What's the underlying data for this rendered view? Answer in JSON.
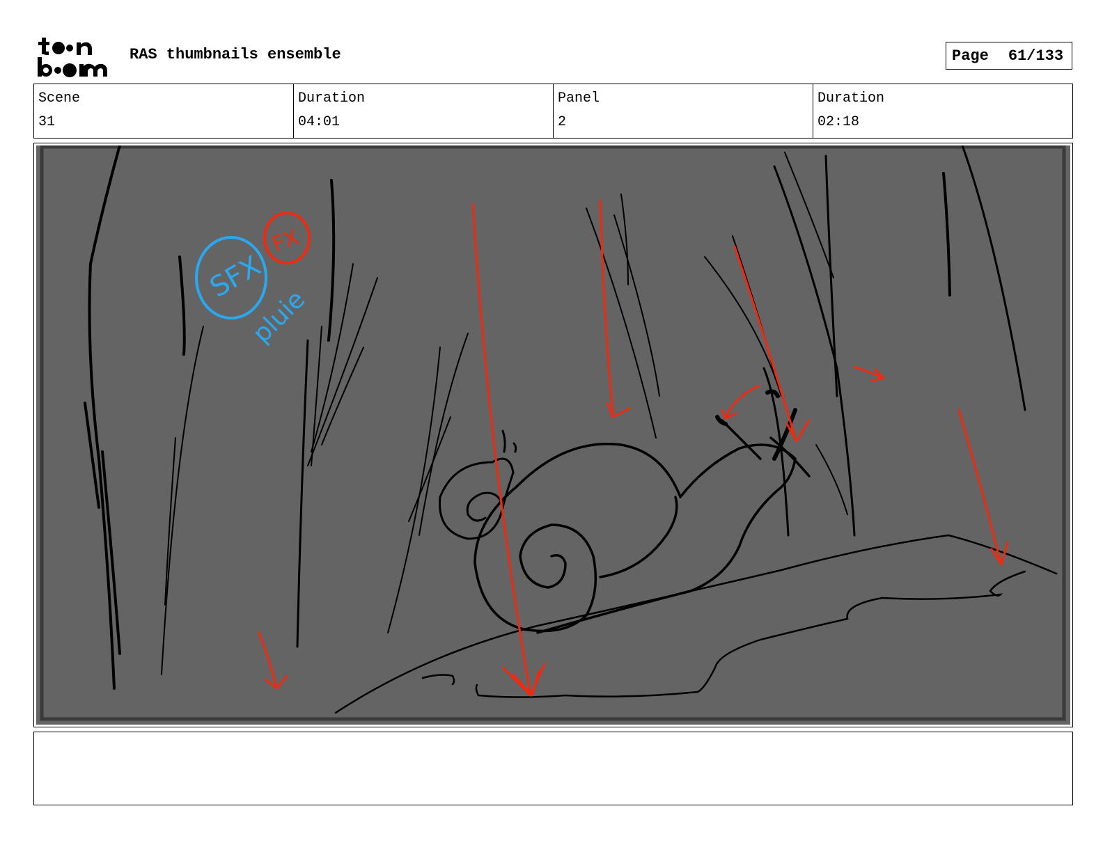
{
  "header": {
    "project_title": "RAS thumbnails ensemble",
    "page_label": "Page",
    "page_value": "61/133"
  },
  "logo": {
    "text": "toonboom"
  },
  "info": {
    "scene_label": "Scene",
    "scene_value": "31",
    "scene_duration_label": "Duration",
    "scene_duration_value": "04:01",
    "panel_label": "Panel",
    "panel_value": "2",
    "panel_duration_label": "Duration",
    "panel_duration_value": "02:18"
  },
  "panel": {
    "background_color": "#646464",
    "annotations": {
      "sfx_text": "SFX",
      "fx_text": "FX",
      "pluie_text": "pluie",
      "sfx_color": "#2aa8f0",
      "fx_color": "#f02a10"
    }
  },
  "notes": {
    "text": ""
  }
}
